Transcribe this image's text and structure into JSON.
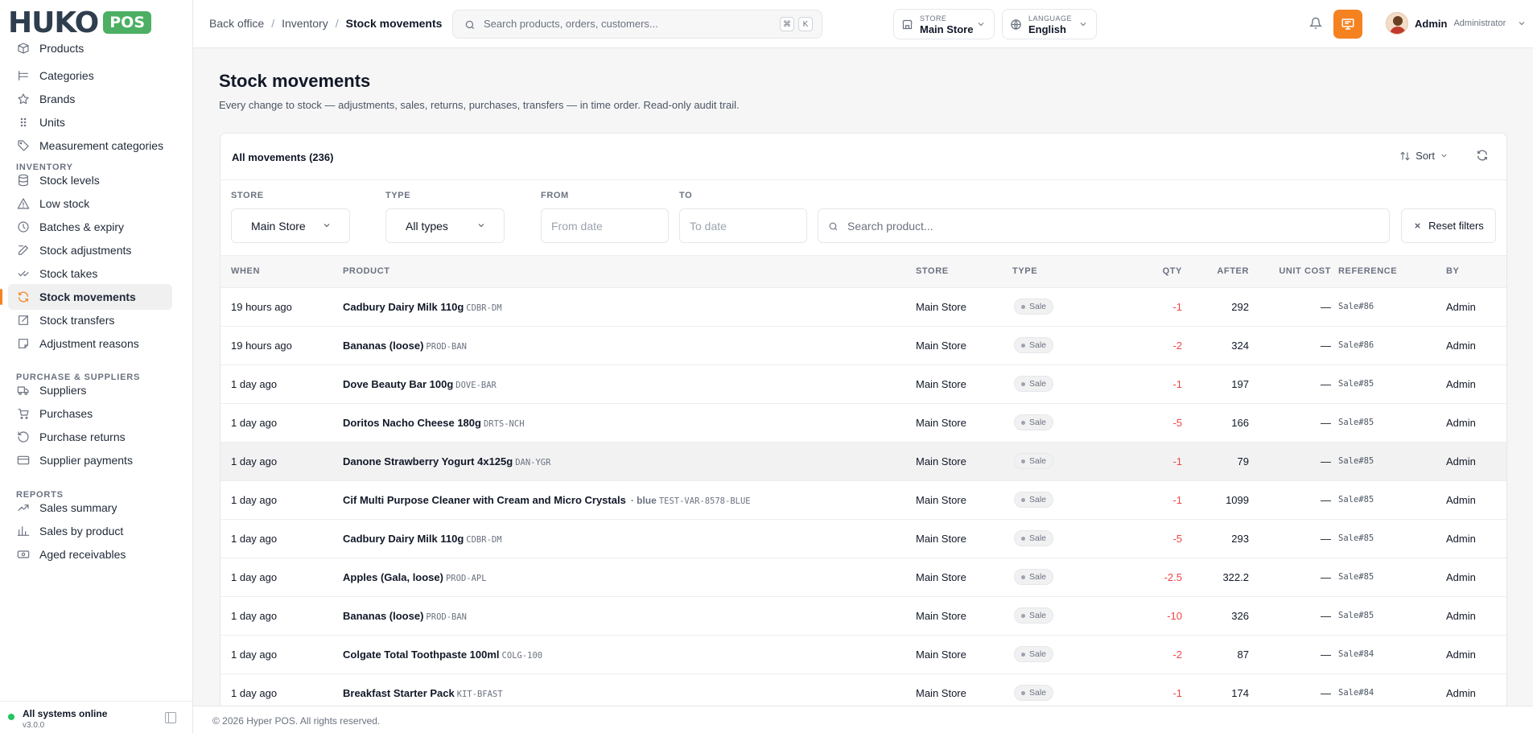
{
  "brand": {
    "word": "HUKO",
    "badge": "POS"
  },
  "sidebar": {
    "catalog_items": [
      {
        "label": "Products",
        "icon": "package-icon"
      },
      {
        "label": "Categories",
        "icon": "list-tree-icon"
      },
      {
        "label": "Brands",
        "icon": "star-icon"
      },
      {
        "label": "Units",
        "icon": "grip-icon"
      },
      {
        "label": "Measurement categories",
        "icon": "tag-icon"
      }
    ],
    "inventory_title": "INVENTORY",
    "inventory_items": [
      {
        "label": "Stock levels",
        "icon": "database-icon"
      },
      {
        "label": "Low stock",
        "icon": "warning-icon"
      },
      {
        "label": "Batches & expiry",
        "icon": "clock-icon"
      },
      {
        "label": "Stock adjustments",
        "icon": "edit-icon"
      },
      {
        "label": "Stock takes",
        "icon": "check-list-icon"
      },
      {
        "label": "Stock movements",
        "icon": "refresh-icon",
        "active": true
      },
      {
        "label": "Stock transfers",
        "icon": "external-link-icon"
      },
      {
        "label": "Adjustment reasons",
        "icon": "note-icon"
      }
    ],
    "purchase_title": "PURCHASE & SUPPLIERS",
    "purchase_items": [
      {
        "label": "Suppliers",
        "icon": "truck-icon"
      },
      {
        "label": "Purchases",
        "icon": "cart-icon"
      },
      {
        "label": "Purchase returns",
        "icon": "undo-icon"
      },
      {
        "label": "Supplier payments",
        "icon": "card-icon"
      }
    ],
    "reports_title": "REPORTS",
    "reports_items": [
      {
        "label": "Sales summary",
        "icon": "trend-up-icon"
      },
      {
        "label": "Sales by product",
        "icon": "bar-chart-icon"
      },
      {
        "label": "Aged receivables",
        "icon": "banknote-icon"
      }
    ],
    "status": {
      "title": "All systems online",
      "version": "v3.0.0"
    }
  },
  "header": {
    "breadcrumb": [
      "Back office",
      "Inventory",
      "Stock movements"
    ],
    "search_placeholder": "Search products, orders, customers...",
    "kbd": [
      "⌘",
      "K"
    ],
    "store_label": "STORE",
    "store_value": "Main Store",
    "language_label": "LANGUAGE",
    "language_value": "English",
    "user_name": "Admin",
    "user_role": "Administrator"
  },
  "page": {
    "title": "Stock movements",
    "subtitle": "Every change to stock — adjustments, sales, returns, purchases, transfers — in time order. Read-only audit trail."
  },
  "card": {
    "title": "All movements (236)",
    "sort_label": "Sort",
    "filters": {
      "store_label": "STORE",
      "store_value": "Main Store",
      "type_label": "TYPE",
      "type_value": "All types",
      "from_label": "FROM",
      "from_placeholder": "From date",
      "to_label": "TO",
      "to_placeholder": "To date",
      "product_placeholder": "Search product...",
      "reset_label": "Reset filters"
    },
    "columns": [
      "WHEN",
      "PRODUCT",
      "STORE",
      "TYPE",
      "QTY",
      "AFTER",
      "UNIT COST",
      "REFERENCE",
      "BY"
    ],
    "rows": [
      {
        "when": "19 hours ago",
        "product": "Cadbury Dairy Milk 110g",
        "variant": "",
        "sku": "CDBR-DM",
        "store": "Main Store",
        "type": "Sale",
        "qty": "-1",
        "after": "292",
        "cost": "—",
        "ref": "Sale#86",
        "by": "Admin"
      },
      {
        "when": "19 hours ago",
        "product": "Bananas (loose)",
        "variant": "",
        "sku": "PROD-BAN",
        "store": "Main Store",
        "type": "Sale",
        "qty": "-2",
        "after": "324",
        "cost": "—",
        "ref": "Sale#86",
        "by": "Admin"
      },
      {
        "when": "1 day ago",
        "product": "Dove Beauty Bar 100g",
        "variant": "",
        "sku": "DOVE-BAR",
        "store": "Main Store",
        "type": "Sale",
        "qty": "-1",
        "after": "197",
        "cost": "—",
        "ref": "Sale#85",
        "by": "Admin"
      },
      {
        "when": "1 day ago",
        "product": "Doritos Nacho Cheese 180g",
        "variant": "",
        "sku": "DRTS-NCH",
        "store": "Main Store",
        "type": "Sale",
        "qty": "-5",
        "after": "166",
        "cost": "—",
        "ref": "Sale#85",
        "by": "Admin"
      },
      {
        "when": "1 day ago",
        "product": "Danone Strawberry Yogurt 4x125g",
        "variant": "",
        "sku": "DAN-YGR",
        "store": "Main Store",
        "type": "Sale",
        "qty": "-1",
        "after": "79",
        "cost": "—",
        "ref": "Sale#85",
        "by": "Admin"
      },
      {
        "when": "1 day ago",
        "product": "Cif Multi Purpose Cleaner with Cream and Micro Crystals",
        "variant": "· blue",
        "sku": "TEST-VAR-8578-BLUE",
        "store": "Main Store",
        "type": "Sale",
        "qty": "-1",
        "after": "1099",
        "cost": "—",
        "ref": "Sale#85",
        "by": "Admin"
      },
      {
        "when": "1 day ago",
        "product": "Cadbury Dairy Milk 110g",
        "variant": "",
        "sku": "CDBR-DM",
        "store": "Main Store",
        "type": "Sale",
        "qty": "-5",
        "after": "293",
        "cost": "—",
        "ref": "Sale#85",
        "by": "Admin"
      },
      {
        "when": "1 day ago",
        "product": "Apples (Gala, loose)",
        "variant": "",
        "sku": "PROD-APL",
        "store": "Main Store",
        "type": "Sale",
        "qty": "-2.5",
        "after": "322.2",
        "cost": "—",
        "ref": "Sale#85",
        "by": "Admin"
      },
      {
        "when": "1 day ago",
        "product": "Bananas (loose)",
        "variant": "",
        "sku": "PROD-BAN",
        "store": "Main Store",
        "type": "Sale",
        "qty": "-10",
        "after": "326",
        "cost": "—",
        "ref": "Sale#85",
        "by": "Admin"
      },
      {
        "when": "1 day ago",
        "product": "Colgate Total Toothpaste 100ml",
        "variant": "",
        "sku": "COLG-100",
        "store": "Main Store",
        "type": "Sale",
        "qty": "-2",
        "after": "87",
        "cost": "—",
        "ref": "Sale#84",
        "by": "Admin"
      },
      {
        "when": "1 day ago",
        "product": "Breakfast Starter Pack",
        "variant": "",
        "sku": "KIT-BFAST",
        "store": "Main Store",
        "type": "Sale",
        "qty": "-1",
        "after": "174",
        "cost": "—",
        "ref": "Sale#84",
        "by": "Admin"
      }
    ]
  },
  "footer": "© 2026 Hyper POS. All rights reserved.",
  "colors": {
    "accent": "#f58220",
    "brand_green": "#4caf63",
    "negative": "#ef4444",
    "online": "#22c55e"
  }
}
